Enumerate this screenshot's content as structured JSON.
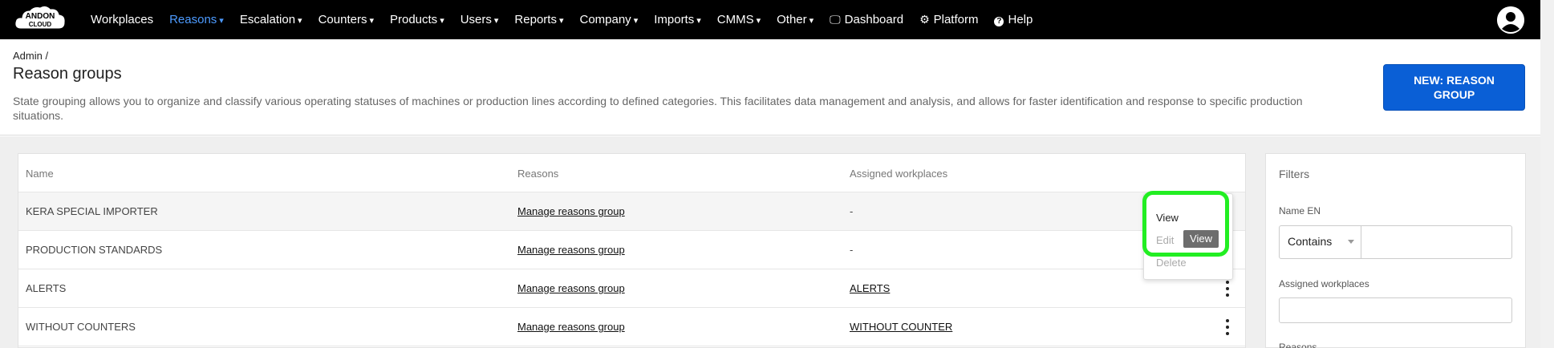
{
  "nav": {
    "logo_text": "ANDON CLOUD",
    "items": [
      {
        "label": "Workplaces",
        "caret": "",
        "icon": ""
      },
      {
        "label": "Reasons",
        "caret": "▾",
        "icon": ""
      },
      {
        "label": "Escalation",
        "caret": "▾",
        "icon": ""
      },
      {
        "label": "Counters",
        "caret": "▾",
        "icon": ""
      },
      {
        "label": "Products",
        "caret": "▾",
        "icon": ""
      },
      {
        "label": "Users",
        "caret": "▾",
        "icon": ""
      },
      {
        "label": "Reports",
        "caret": "▾",
        "icon": ""
      },
      {
        "label": "Company",
        "caret": "▾",
        "icon": ""
      },
      {
        "label": "Imports",
        "caret": "▾",
        "icon": ""
      },
      {
        "label": "CMMS",
        "caret": "▾",
        "icon": ""
      },
      {
        "label": "Other",
        "caret": "▾",
        "icon": ""
      },
      {
        "label": "Dashboard",
        "caret": "",
        "icon": "🖵"
      },
      {
        "label": "Platform",
        "caret": "",
        "icon": "⚙"
      },
      {
        "label": "Help",
        "caret": "",
        "icon": "?"
      }
    ],
    "active_item": "Reasons",
    "active_color": "#4d9bff"
  },
  "header": {
    "breadcrumb": "Admin /",
    "title": "Reason groups",
    "description": "State grouping allows you to organize and classify various operating statuses of machines or production lines according to defined categories. This facilitates data management and analysis, and allows for faster identification and response to specific production situations.",
    "new_button": "NEW: REASON GROUP"
  },
  "table": {
    "columns": {
      "name": "Name",
      "reasons": "Reasons",
      "workplaces": "Assigned workplaces"
    },
    "rows": [
      {
        "name": "KERA SPECIAL IMPORTER",
        "reasons": "Manage reasons group",
        "workplaces": "-",
        "workplaces_link": false
      },
      {
        "name": "PRODUCTION STANDARDS",
        "reasons": "Manage reasons group",
        "workplaces": "-",
        "workplaces_link": false
      },
      {
        "name": "ALERTS",
        "reasons": "Manage reasons group",
        "workplaces": "ALERTS",
        "workplaces_link": true
      },
      {
        "name": "WITHOUT COUNTERS",
        "reasons": "Manage reasons group",
        "workplaces": "WITHOUT COUNTER",
        "workplaces_link": true
      }
    ]
  },
  "context_menu": {
    "view": "View",
    "edit": "Edit",
    "delete": "Delete",
    "tooltip": "View"
  },
  "filters": {
    "title": "Filters",
    "name_label": "Name EN",
    "operator": "Contains",
    "name_value": "",
    "workplaces_label": "Assigned workplaces",
    "workplaces_value": "",
    "reasons_label": "Reasons"
  },
  "colors": {
    "primary_button": "#0a5fd6",
    "highlight": "#22ee22",
    "nav_background": "#000000"
  }
}
